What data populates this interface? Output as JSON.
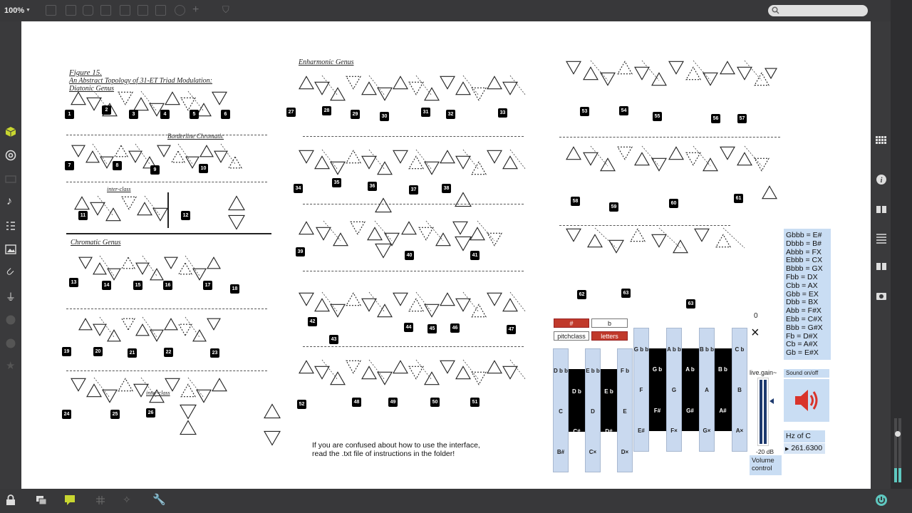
{
  "toolbar": {
    "zoom": "100%"
  },
  "patch": {
    "figure_title": "Figure 15.",
    "figure_subtitle": "An Abstract Topology of 31-ET Triad Modulation:",
    "diatonic_heading": "Diatonic Genus",
    "enharmonic_heading": "Enharmonic Genus",
    "chromatic_heading": "Chromatic Genus",
    "borderline_heading": "Borderline Chromatic",
    "interclass_label": "inter-class",
    "help_line1": "If you are confused about how to use the interface,",
    "help_line2": "read the .txt file of instructions in the folder!",
    "sharp_button": "#",
    "flat_button": "b",
    "pitchclass_button": "pitchclass",
    "letters_button": "letters",
    "number_display": "0",
    "close_symbol": "×",
    "gain_label": "live.gain~",
    "gain_value": "-20 dB",
    "volume_label": "Volume control",
    "sound_label": "Sound on/off",
    "hz_label": "Hz of C",
    "hz_value": "261.6300",
    "enharmonics": [
      "Gbbb = E#",
      "Dbbb = B#",
      "Abbb = FX",
      "Ebbb = CX",
      "Bbbb = GX",
      "Fbb = DX",
      "Cbb = AX",
      "Gbb = EX",
      "Dbb = BX",
      "Abb = F#X",
      "Ebb = C#X",
      "Bbb = G#X",
      "Fb = D#X",
      "Cb = A#X",
      "Gb = E#X"
    ],
    "keys_top": [
      "D b b",
      "E b b",
      "F b",
      "G b b",
      "A b b",
      "B b b",
      "C b"
    ],
    "keys_mid": [
      "C",
      "D",
      "E",
      "F",
      "G",
      "A",
      "B"
    ],
    "keys_flat": [
      "D b",
      "E b",
      "G b",
      "A b",
      "B b"
    ],
    "keys_sharp": [
      "C#",
      "D#",
      "F#",
      "G#",
      "A#"
    ],
    "keys_bottom": [
      "B#",
      "C×",
      "D×",
      "E#",
      "F×",
      "G×",
      "A×"
    ],
    "figure_numbers": [
      "1",
      "2",
      "3",
      "4",
      "5",
      "6",
      "7",
      "8",
      "9",
      "10",
      "11",
      "12",
      "13",
      "14",
      "15",
      "16",
      "17",
      "18",
      "19",
      "20",
      "21",
      "22",
      "23",
      "24",
      "25",
      "26",
      "27",
      "28",
      "29",
      "30",
      "31",
      "32",
      "33",
      "34",
      "35",
      "36",
      "37",
      "38",
      "39",
      "40",
      "41",
      "42",
      "43",
      "44",
      "45",
      "46",
      "47",
      "48",
      "49",
      "50",
      "51",
      "52",
      "53",
      "54",
      "55",
      "56",
      "57",
      "58",
      "59",
      "60",
      "61",
      "62",
      "63"
    ]
  },
  "colors": {
    "red": "#c0392b",
    "key_blue": "#c9d9ef",
    "panel_blue": "#c9ddf3"
  }
}
